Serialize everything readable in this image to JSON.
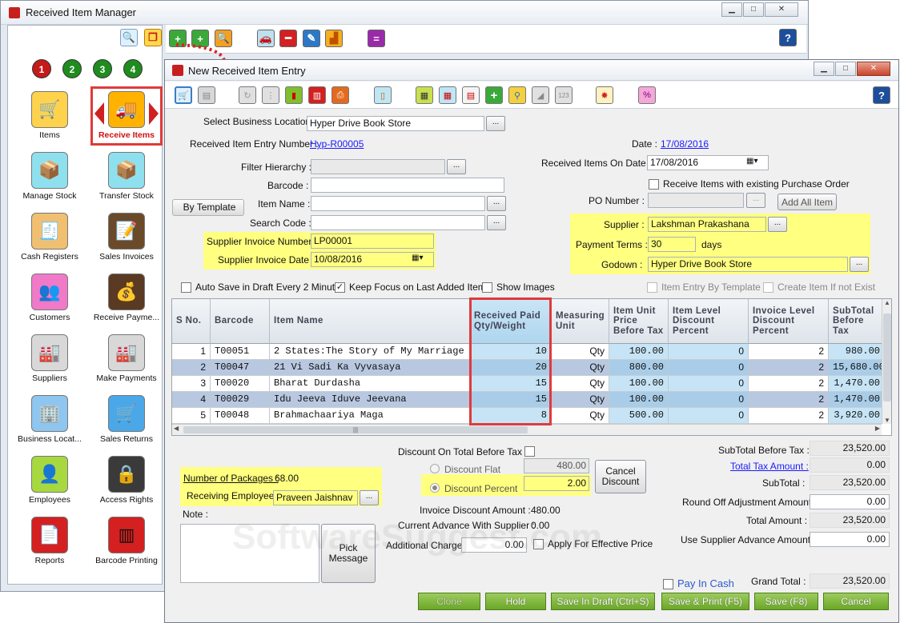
{
  "outer": {
    "title": "Received Item Manager",
    "sidebar": {
      "numbers": [
        "1",
        "2",
        "3",
        "4"
      ],
      "items": [
        {
          "label": "Items",
          "icon": "cart-icon"
        },
        {
          "label": "Receive Items",
          "icon": "truck-icon"
        },
        {
          "label": "Manage Stock",
          "icon": "hand-truck-icon"
        },
        {
          "label": "Transfer Stock",
          "icon": "boxes-icon"
        },
        {
          "label": "Cash Registers",
          "icon": "cash-register-icon"
        },
        {
          "label": "Sales Invoices",
          "icon": "invoice-icon"
        },
        {
          "label": "Customers",
          "icon": "people-icon"
        },
        {
          "label": "Receive Payme...",
          "icon": "money-bag-icon"
        },
        {
          "label": "Suppliers",
          "icon": "factory-icon"
        },
        {
          "label": "Make Payments",
          "icon": "factory-arrow-icon"
        },
        {
          "label": "Business Locat...",
          "icon": "building-icon"
        },
        {
          "label": "Sales Returns",
          "icon": "cart-return-icon"
        },
        {
          "label": "Employees",
          "icon": "employee-icon"
        },
        {
          "label": "Access Rights",
          "icon": "lock-key-icon"
        },
        {
          "label": "Reports",
          "icon": "report-icon"
        },
        {
          "label": "Barcode Printing",
          "icon": "barcode-icon"
        }
      ]
    }
  },
  "inner": {
    "title": "New Received Item Entry",
    "form": {
      "business_location_label": "Select Business Location :",
      "business_location": "Hyper Drive Book Store",
      "entry_number_label": "Received Item Entry Number :",
      "entry_number": "Hyp-R00005",
      "filter_hierarchy_label": "Filter Hierarchy :",
      "barcode_label": "Barcode :",
      "item_name_label": "Item Name :",
      "search_code_label": "Search Code :",
      "by_template": "By Template",
      "supplier_invoice_number_label": "Supplier Invoice Number :",
      "supplier_invoice_number": "LP00001",
      "supplier_invoice_date_label": "Supplier Invoice Date :",
      "supplier_invoice_date": "10/08/2016",
      "date_label": "Date :",
      "date": "17/08/2016",
      "received_on_label": "Received Items On Date :",
      "received_on": "17/08/2016",
      "with_po_label": "Receive Items with existing Purchase Order",
      "po_number_label": "PO Number :",
      "add_all_item": "Add All Item",
      "supplier_label": "Supplier :",
      "supplier": "Lakshman Prakashana",
      "payment_terms_label": "Payment Terms :",
      "payment_terms": "30",
      "days": "days",
      "godown_label": "Godown :",
      "godown": "Hyper Drive Book Store",
      "auto_save": "Auto Save in Draft Every 2 Minutes",
      "keep_focus": "Keep Focus on Last Added Item",
      "show_images": "Show Images",
      "item_entry_template": "Item Entry By Template",
      "create_item": "Create Item If not Exist"
    },
    "grid": {
      "headers": [
        "S No.",
        "Barcode",
        "Item Name",
        "Received Paid Qty/Weight",
        "Measuring Unit",
        "Item Unit Price Before Tax",
        "Item Level Discount Percent",
        "Invoice Level Discount Percent",
        "SubTotal Before Tax"
      ],
      "rows": [
        [
          "1",
          "T00051",
          "2 States:The Story of My Marriage",
          "10",
          "Qty",
          "100.00",
          "0",
          "2",
          "980.00"
        ],
        [
          "2",
          "T00047",
          "21 Vi Sadi Ka Vyvasaya",
          "20",
          "Qty",
          "800.00",
          "0",
          "2",
          "15,680.00"
        ],
        [
          "3",
          "T00020",
          "Bharat Durdasha",
          "15",
          "Qty",
          "100.00",
          "0",
          "2",
          "1,470.00"
        ],
        [
          "4",
          "T00029",
          "Idu Jeeva Iduve Jeevana",
          "15",
          "Qty",
          "100.00",
          "0",
          "2",
          "1,470.00"
        ],
        [
          "5",
          "T00048",
          "Brahmachaariya Maga",
          "8",
          "Qty",
          "500.00",
          "0",
          "2",
          "3,920.00"
        ]
      ]
    },
    "bottom": {
      "packages_label": "Number of Packages :",
      "packages": "68.00",
      "receiving_employee_label": "Receiving Employee :",
      "receiving_employee": "Praveen Jaishnav",
      "note_label": "Note :",
      "pick_message": "Pick Message",
      "discount_total_label": "Discount On Total Before Tax :",
      "discount_flat_label": "Discount Flat",
      "discount_flat": "480.00",
      "discount_percent_label": "Discount Percent",
      "discount_percent": "2.00",
      "cancel_discount": "Cancel Discount",
      "invoice_discount_label": "Invoice Discount Amount :",
      "invoice_discount": "480.00",
      "current_advance_label": "Current Advance With Supplier :",
      "current_advance": "0.00",
      "additional_charges_label": "Additional Charges :",
      "additional_charges": "0.00",
      "apply_effective": "Apply For Effective Price",
      "subtotal_before_tax_label": "SubTotal Before Tax :",
      "subtotal_before_tax": "23,520.00",
      "total_tax_label": "Total Tax Amount :",
      "total_tax": "0.00",
      "subtotal_label": "SubTotal :",
      "subtotal": "23,520.00",
      "round_off_label": "Round Off Adjustment Amount :",
      "round_off": "0.00",
      "total_amount_label": "Total Amount :",
      "total_amount": "23,520.00",
      "supplier_advance_label": "Use Supplier Advance Amount :",
      "supplier_advance": "0.00",
      "pay_in_cash": "Pay In Cash",
      "grand_total_label": "Grand Total :",
      "grand_total": "23,520.00"
    },
    "buttons": {
      "clone": "Clone",
      "hold": "Hold",
      "save_draft": "Save In Draft (Ctrl+S)",
      "save_print": "Save & Print (F5)",
      "save": "Save (F8)",
      "cancel": "Cancel"
    }
  },
  "watermark": "SoftwareSuggest.com",
  "colors": {
    "highlight": "#ffff80",
    "accent_green": "#6ba727",
    "selected_row": "#b8c8e0",
    "qty_column": "#c6e4f5"
  }
}
